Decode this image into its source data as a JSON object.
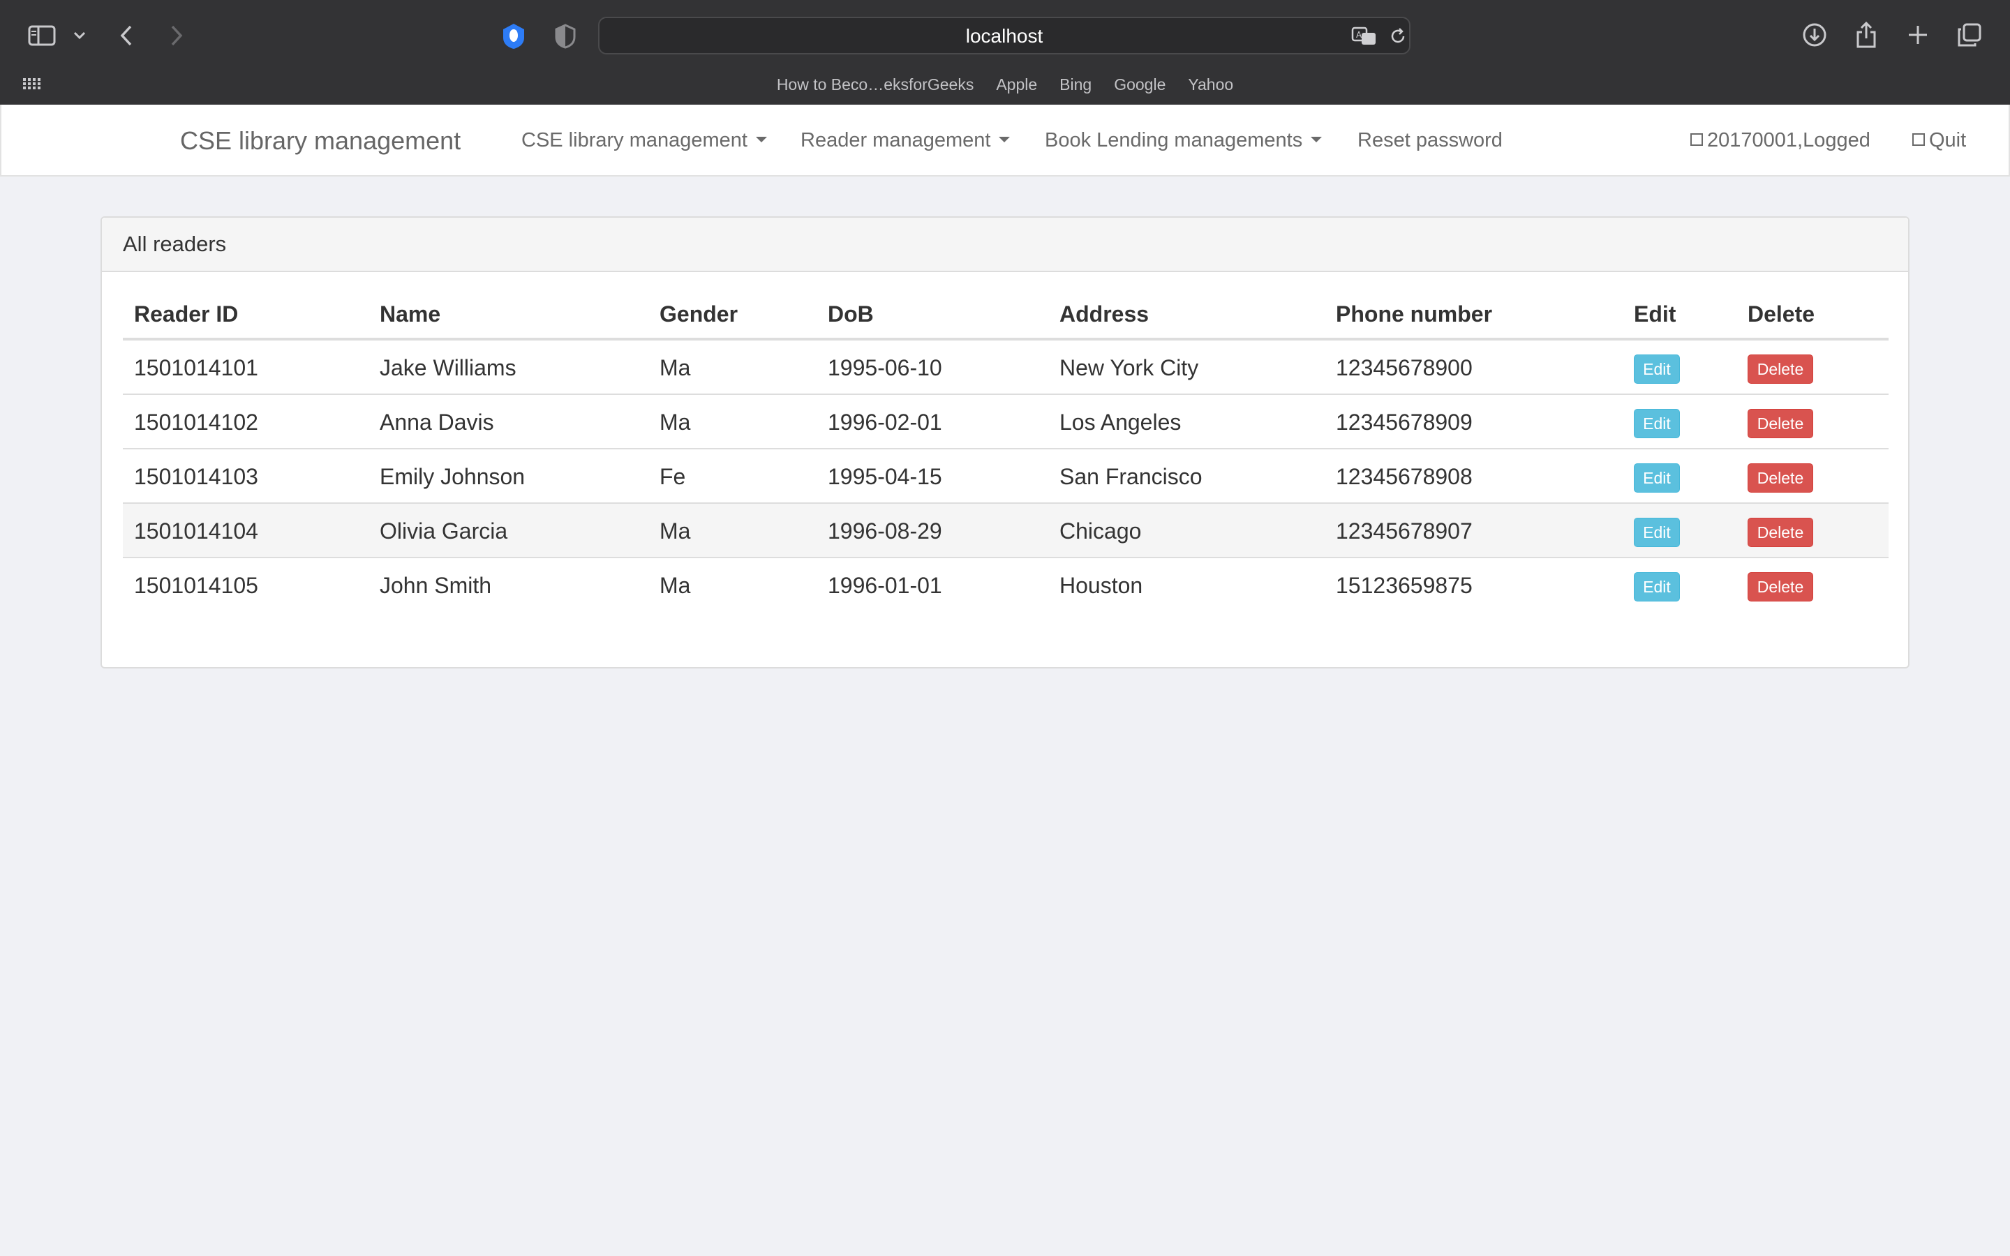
{
  "browser": {
    "url": "localhost",
    "bookmarks": [
      "How to Beco…eksforGeeks",
      "Apple",
      "Bing",
      "Google",
      "Yahoo"
    ],
    "icons": [
      "sidebar-icon",
      "chevron-down-icon",
      "back-icon",
      "forward-icon",
      "privacy-shield-icon",
      "shield-icon",
      "translate-icon",
      "reload-icon",
      "download-icon",
      "share-icon",
      "new-tab-icon",
      "tabs-overview-icon",
      "grid-icon"
    ]
  },
  "navbar": {
    "brand": "CSE library management",
    "menus": [
      {
        "label": "CSE library management"
      },
      {
        "label": "Reader management"
      },
      {
        "label": "Book Lending managements"
      }
    ],
    "reset_password": "Reset password",
    "user_status": "20170001,Logged",
    "quit": "Quit"
  },
  "panel": {
    "title": "All readers",
    "columns": [
      "Reader ID",
      "Name",
      "Gender",
      "DoB",
      "Address",
      "Phone number",
      "Edit",
      "Delete"
    ],
    "rows": [
      {
        "id": "1501014101",
        "name": "Jake Williams",
        "gender": "Ma",
        "dob": "1995-06-10",
        "address": "New York City",
        "phone": "12345678900",
        "edit": "Edit",
        "delete": "Delete"
      },
      {
        "id": "1501014102",
        "name": "Anna Davis",
        "gender": "Ma",
        "dob": "1996-02-01",
        "address": "Los Angeles",
        "phone": "12345678909",
        "edit": "Edit",
        "delete": "Delete"
      },
      {
        "id": "1501014103",
        "name": "Emily Johnson",
        "gender": "Fe",
        "dob": "1995-04-15",
        "address": "San Francisco",
        "phone": "12345678908",
        "edit": "Edit",
        "delete": "Delete"
      },
      {
        "id": "1501014104",
        "name": "Olivia Garcia",
        "gender": "Ma",
        "dob": "1996-08-29",
        "address": "Chicago",
        "phone": "12345678907",
        "edit": "Edit",
        "delete": "Delete"
      },
      {
        "id": "1501014105",
        "name": "John Smith",
        "gender": "Ma",
        "dob": "1996-01-01",
        "address": "Houston",
        "phone": "15123659875",
        "edit": "Edit",
        "delete": "Delete"
      }
    ]
  },
  "colors": {
    "edit_button": "#5bc0de",
    "delete_button": "#d9534f",
    "chrome_bg": "#333335",
    "page_bg": "#f0f1f5"
  }
}
